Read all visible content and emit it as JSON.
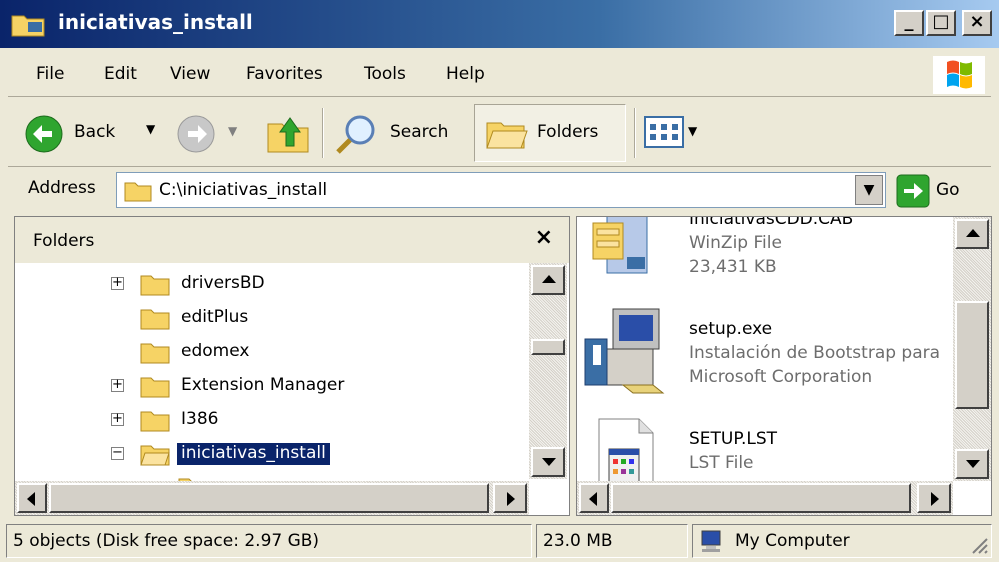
{
  "window": {
    "title": "iniciativas_install",
    "controls": {
      "minimize": "_",
      "maximize": "□",
      "close": "×"
    }
  },
  "menu": {
    "items": [
      "File",
      "Edit",
      "View",
      "Favorites",
      "Tools",
      "Help"
    ]
  },
  "toolbar": {
    "back_label": "Back",
    "search_label": "Search",
    "folders_label": "Folders"
  },
  "address": {
    "label": "Address",
    "value": "C:\\iniciativas_install",
    "go_label": "Go"
  },
  "folders_pane": {
    "title": "Folders",
    "close": "×",
    "tree": [
      {
        "label": "driversBD",
        "expander": "+"
      },
      {
        "label": "editPlus",
        "expander": ""
      },
      {
        "label": "edomex",
        "expander": ""
      },
      {
        "label": "Extension Manager",
        "expander": "+"
      },
      {
        "label": "I386",
        "expander": "+"
      },
      {
        "label": "iniciativas_install",
        "expander": "−",
        "selected": true
      }
    ]
  },
  "files": [
    {
      "name": "IniciativasCDD.CAB",
      "type": "WinZip File",
      "size": "23,431 KB",
      "icon": "winzip-icon"
    },
    {
      "name": "setup.exe",
      "type": "Instalación de Bootstrap para",
      "size": "Microsoft Corporation",
      "icon": "setup-computer-icon"
    },
    {
      "name": "SETUP.LST",
      "type": "LST File",
      "size": "",
      "icon": "lst-file-icon"
    }
  ],
  "status": {
    "objects": "5 objects (Disk free space: 2.97 GB)",
    "size": "23.0 MB",
    "location": "My Computer"
  },
  "colors": {
    "titlebar_start": "#0a246a",
    "selection": "#0a246a",
    "chrome": "#ece9d8"
  }
}
